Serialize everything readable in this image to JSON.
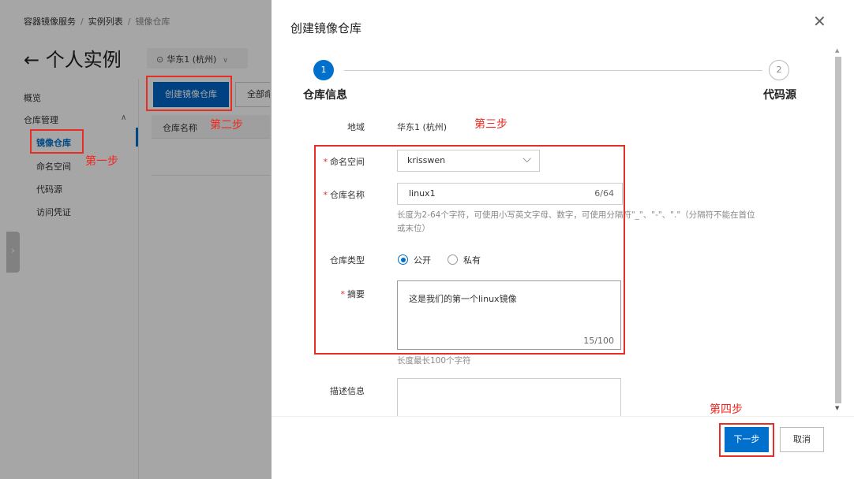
{
  "breadcrumb": [
    "容器镜像服务",
    "实例列表",
    "镜像仓库"
  ],
  "page_title": "← 个人实例",
  "region_selector": {
    "icon": "location-pin-icon",
    "value": "华东1 (杭州)"
  },
  "sidebar": {
    "overview": "概览",
    "repo_management": "仓库管理",
    "items": [
      "镜像仓库",
      "命名空间",
      "代码源",
      "访问凭证"
    ]
  },
  "toolbar": {
    "create_button": "创建镜像仓库",
    "namespace_filter": "全部命"
  },
  "table": {
    "headers": [
      "仓库名称"
    ]
  },
  "annotations": {
    "step1": "第一步",
    "step2": "第二步",
    "step3": "第三步",
    "step4": "第四步"
  },
  "drawer": {
    "title": "创建镜像仓库",
    "steps": [
      {
        "number": "1",
        "label": "仓库信息"
      },
      {
        "number": "2",
        "label": "代码源"
      }
    ],
    "form": {
      "region_label": "地域",
      "region_value": "华东1 (杭州)",
      "namespace_label": "命名空间",
      "namespace_value": "krisswen",
      "repo_name_label": "仓库名称",
      "repo_name_value": "linux1",
      "repo_name_count": "6/64",
      "repo_name_hint_1": "长度为2-64个字符，可使用小写英文字母、数字，可使用分隔符\"_\"、\"-\"、\".\"（分隔符不能在首位",
      "repo_name_hint_2": "或末位）",
      "repo_type_label": "仓库类型",
      "repo_type_options": [
        "公开",
        "私有"
      ],
      "repo_type_selected": "公开",
      "summary_label": "摘要",
      "summary_value": "这是我们的第一个linux镜像",
      "summary_count": "15/100",
      "summary_hint": "长度最长100个字符",
      "description_label": "描述信息"
    },
    "footer": {
      "next_button": "下一步",
      "cancel_button": "取消"
    }
  },
  "colors": {
    "primary": "#0070cc",
    "annotation": "#e62e24",
    "overlay": "rgba(0,0,0,0.35)"
  }
}
